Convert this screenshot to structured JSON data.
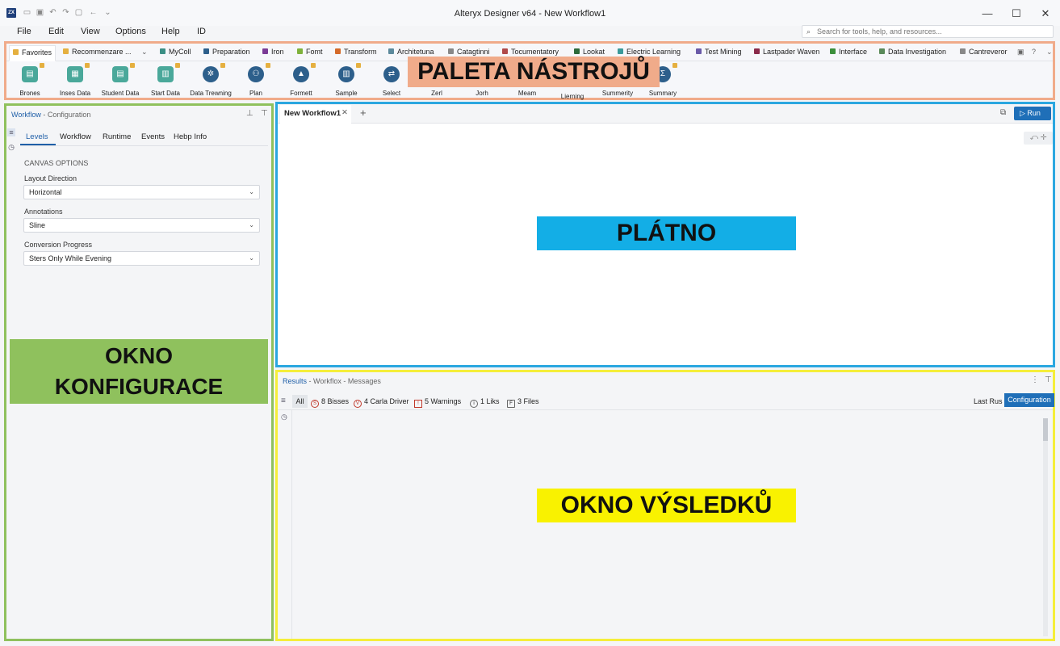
{
  "titlebar": {
    "logo": "ZX",
    "title": "Alteryx Designer v64 - New Workflow1",
    "minimize": "—",
    "maximize": "☐",
    "close": "✕"
  },
  "menu": [
    "File",
    "Edit",
    "View",
    "Options",
    "Help",
    "ID"
  ],
  "search": {
    "placeholder": "Search for tools, help, and resources..."
  },
  "palette": {
    "label": "PALETA NÁSTROJŮ",
    "tabs": [
      {
        "label": "Favorites",
        "color": "#e5b040"
      },
      {
        "label": "Recommenzare ...",
        "color": "#e5b040"
      },
      {
        "label": "MyColl",
        "color": "#3b8f85"
      },
      {
        "label": "Preparation",
        "color": "#2d5f8b"
      },
      {
        "label": "Iron",
        "color": "#7b3b96"
      },
      {
        "label": "Fomt",
        "color": "#7fb23c"
      },
      {
        "label": "Transform",
        "color": "#d46a2a"
      },
      {
        "label": "Architetuna",
        "color": "#5c8a9c"
      },
      {
        "label": "Catagtinni",
        "color": "#888888"
      },
      {
        "label": "Tocumentatory",
        "color": "#b04a4a"
      },
      {
        "label": "Lookat",
        "color": "#2d6b3b"
      },
      {
        "label": "Electric Learning",
        "color": "#3a9a9a"
      },
      {
        "label": "Test Mining",
        "color": "#6a5aa8"
      },
      {
        "label": "Lastpader Waven",
        "color": "#8a2a4a"
      },
      {
        "label": "Interface",
        "color": "#3b8f3b"
      },
      {
        "label": "Data Investigation",
        "color": "#5a8a5a"
      },
      {
        "label": "Cantreveror",
        "color": "#888888"
      }
    ],
    "tools": [
      "Brones",
      "Inses Data",
      "Student Data",
      "Start Data",
      "Data Trewning",
      "Plan",
      "Formett",
      "Sample",
      "Select",
      "Zerl",
      "Jorh",
      "Meam",
      "Lierning",
      "Summerity",
      "Summary"
    ]
  },
  "config": {
    "header_title": "Workflow",
    "header_sub": " - Configuration",
    "tabs": [
      "Levels",
      "Workflow",
      "Runtime",
      "Events",
      "Hebp Info"
    ],
    "section": "CANVAS OPTIONS",
    "fields": [
      {
        "label": "Layout Direction",
        "value": "Horizontal"
      },
      {
        "label": "Annotations",
        "value": "Sline"
      },
      {
        "label": "Conversion Progress",
        "value": "Sters Only While Evening"
      }
    ],
    "label_line1": "OKNO",
    "label_line2": "KONFIGURACE"
  },
  "canvas": {
    "tab": "New Workflow1",
    "tab_close": "✕",
    "add_tab": "+",
    "run": "▷  Run",
    "label": "PLÁTNO"
  },
  "results": {
    "header_title": "Results",
    "header_sub": " - Workflox - Messages",
    "all": "All",
    "filters": [
      {
        "label": "8 Bisses",
        "symbol": "S",
        "color": "#c0392b"
      },
      {
        "label": "4 Carla Driver",
        "symbol": "V",
        "color": "#c0392b"
      },
      {
        "label": "5 Warnings",
        "symbol": "!",
        "color": "#c0392b"
      },
      {
        "label": "1 Liks",
        "symbol": "i",
        "color": "#444444"
      },
      {
        "label": "3 Files",
        "symbol": "F",
        "color": "#444444"
      }
    ],
    "last_run": "Last Rus",
    "configuration": "Configuration",
    "label": "OKNO VÝSLEDKŮ"
  }
}
